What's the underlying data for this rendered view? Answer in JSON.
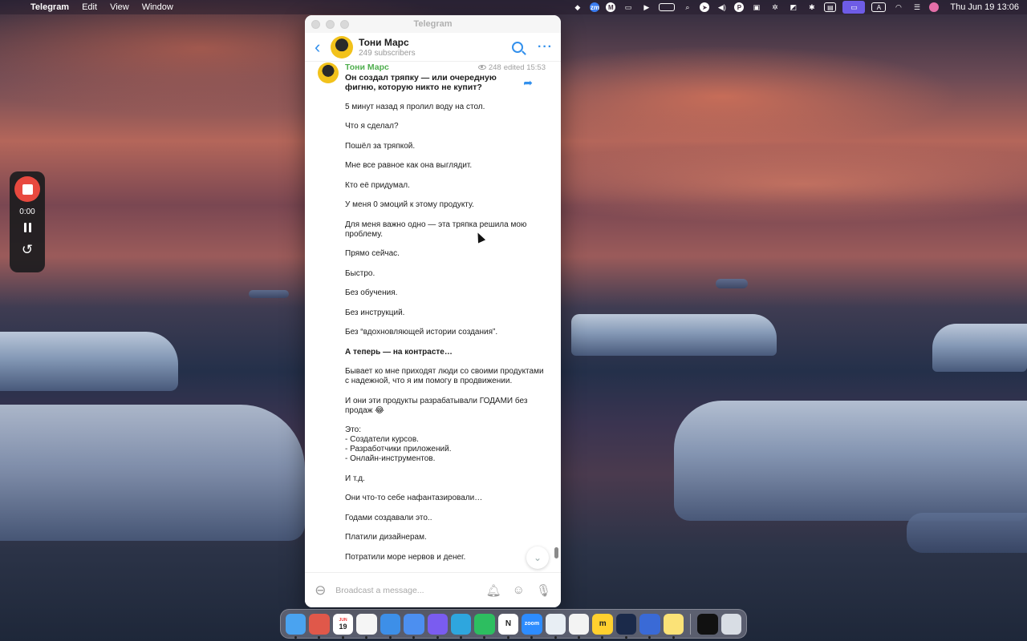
{
  "menubar": {
    "app_name": "Telegram",
    "menus": [
      "Edit",
      "View",
      "Window"
    ],
    "clock": "Thu Jun 19  13:06",
    "icons": [
      "evernote-icon",
      "zoom-icon",
      "mail-icon",
      "display-icon",
      "play-icon",
      "battery-icon",
      "search-icon",
      "telegram-icon",
      "volume-icon",
      "app-icon",
      "gift-icon",
      "settings-icon",
      "nav-icon",
      "bluetooth-icon",
      "notes-icon",
      "screen-mirroring-icon",
      "input-source-icon",
      "wifi-icon",
      "control-center-icon",
      "siri-icon"
    ],
    "zoom_label": "zm",
    "input_source_label": "A"
  },
  "recorder": {
    "time": "0:00"
  },
  "window": {
    "title": "Telegram"
  },
  "channel": {
    "name": "Тони Марс",
    "subscribers": "249 subscribers"
  },
  "message": {
    "author": "Тони Марс",
    "views": "248",
    "edited": "edited 15:53",
    "paragraphs": [
      {
        "text": "Он создал тряпку — или очередную фигню, которую никто не купит?",
        "style": "title"
      },
      {
        "text": "5 минут назад я пролил воду на стол.",
        "style": ""
      },
      {
        "text": "Что я сделал?",
        "style": ""
      },
      {
        "text": "Пошёл за тряпкой.",
        "style": ""
      },
      {
        "text": "Мне все равное как она выглядит.",
        "style": ""
      },
      {
        "text": "Кто её придумал.",
        "style": ""
      },
      {
        "text": "У меня 0 эмоций к этому продукту.",
        "style": ""
      },
      {
        "text": "Для меня важно одно — эта тряпка решила мою проблему.",
        "style": ""
      },
      {
        "text": "Прямо сейчас.",
        "style": ""
      },
      {
        "text": "Быстро.",
        "style": ""
      },
      {
        "text": "Без обучения.",
        "style": ""
      },
      {
        "text": "Без инструкций.",
        "style": ""
      },
      {
        "text": "Без “вдохновляющей истории создания”.",
        "style": ""
      },
      {
        "text": "А теперь — на контрасте…",
        "style": "b"
      },
      {
        "text": "Бывает ко мне приходят люди со своими продуктами с надежной, что я им помогу в продвижении.",
        "style": ""
      },
      {
        "text": "И они эти продукты разрабатывали ГОДАМИ без продаж 😂",
        "style": ""
      },
      {
        "text": "Это:\n- Создатели курсов.\n- Разработчики приложений.\n- Онлайн-инструментов.",
        "style": ""
      },
      {
        "text": "И т.д.",
        "style": ""
      },
      {
        "text": "Они что-то себе нафантазировали…",
        "style": ""
      },
      {
        "text": "Годами создавали это..",
        "style": ""
      },
      {
        "text": "Платили дизайнерам.",
        "style": ""
      },
      {
        "text": "Потратили море нервов и денег.",
        "style": ""
      }
    ]
  },
  "composer": {
    "placeholder": "Broadcast a message..."
  },
  "dock": {
    "items": [
      {
        "name": "finder",
        "label": "",
        "color": "#4aa3f0"
      },
      {
        "name": "launchpad",
        "label": "",
        "color": "#e0584a"
      },
      {
        "name": "calendar",
        "label": "19",
        "sub": "JUN",
        "color": "#ffffff"
      },
      {
        "name": "reminders",
        "label": "",
        "color": "#f5f5f5"
      },
      {
        "name": "mail",
        "label": "",
        "color": "#3d8fe8"
      },
      {
        "name": "testflight",
        "label": "",
        "color": "#4c8ff0"
      },
      {
        "name": "arc",
        "label": "",
        "color": "#7a5cf0"
      },
      {
        "name": "telegram",
        "label": "",
        "color": "#2ea6de"
      },
      {
        "name": "evernote",
        "label": "",
        "color": "#2dbe60"
      },
      {
        "name": "notion",
        "label": "N",
        "color": "#ffffff"
      },
      {
        "name": "zoom",
        "label": "zoom",
        "color": "#2d8cff"
      },
      {
        "name": "figure",
        "label": "",
        "color": "#e8eef4"
      },
      {
        "name": "stickies",
        "label": "",
        "color": "#f3f3f3"
      },
      {
        "name": "miro",
        "label": "m",
        "color": "#ffd02f"
      },
      {
        "name": "steam",
        "label": "",
        "color": "#1b2a4a"
      },
      {
        "name": "xcode-tools",
        "label": "",
        "color": "#3a6ad6"
      },
      {
        "name": "notes",
        "label": "",
        "color": "#fbe277"
      },
      {
        "name": "terminal",
        "label": "",
        "color": "#111111"
      },
      {
        "name": "trash",
        "label": "",
        "color": "#d8dde4"
      }
    ]
  }
}
